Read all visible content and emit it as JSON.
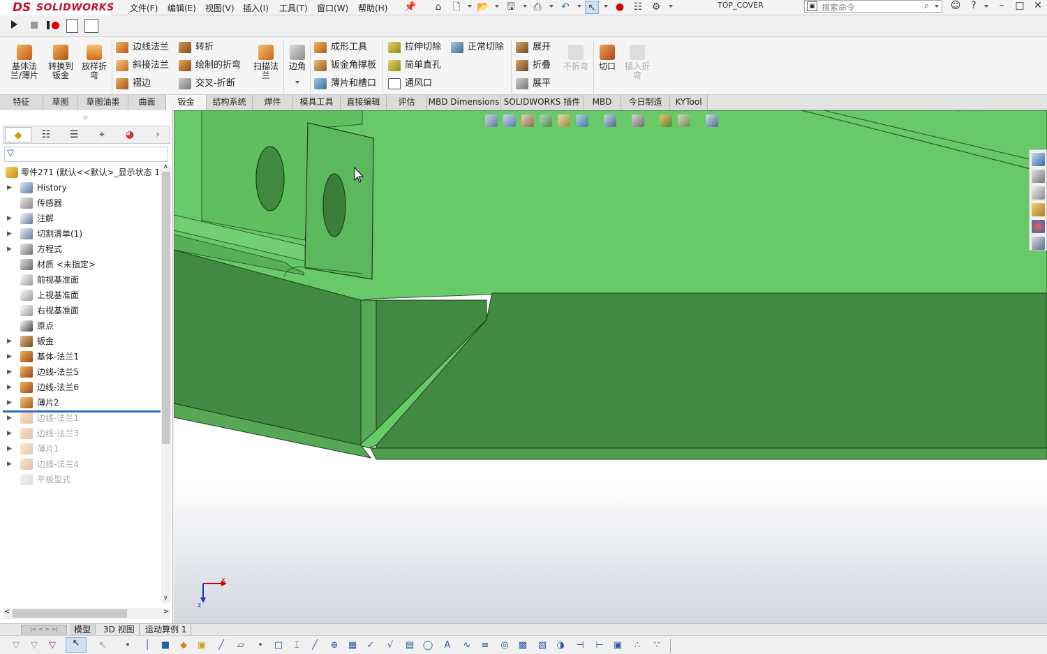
{
  "app": {
    "brand_ds": "DS",
    "brand_name": "SOLIDWORKS",
    "document_title": "TOP_COVER",
    "search_placeholder": "搜索命令"
  },
  "menu": [
    "文件(F)",
    "编辑(E)",
    "视图(V)",
    "插入(I)",
    "工具(T)",
    "窗口(W)",
    "帮助(H)"
  ],
  "ribbon": {
    "big_buttons": [
      {
        "label": "基体法\n兰/薄片",
        "icon": "base-flange-icon"
      },
      {
        "label": "转换到\n钣金",
        "icon": "convert-to-sheet-metal-icon"
      },
      {
        "label": "放样折\n弯",
        "icon": "lofted-bend-icon"
      }
    ],
    "col1": [
      "边线法兰",
      "斜接法兰",
      "褶边"
    ],
    "col2": [
      "转折",
      "绘制的折弯",
      "交叉-折断"
    ],
    "sweep_flange": "扫描法\n兰",
    "corner": "边角",
    "col3": [
      "成形工具",
      "钣金角撑板",
      "薄片和槽口"
    ],
    "col4": [
      "拉伸切除",
      "简单直孔",
      "通风口"
    ],
    "normal_cut": "正常切除",
    "col5": [
      "展开",
      "折叠",
      "展平"
    ],
    "no_bends": "不折弯",
    "rip": "切口",
    "insert_bends": "插入折\n弯"
  },
  "tabs": [
    "特征",
    "草图",
    "草图油墨",
    "曲面",
    "钣金",
    "结构系统",
    "焊件",
    "模具工具",
    "直接编辑",
    "评估",
    "MBD Dimensions",
    "SOLIDWORKS 插件",
    "MBD",
    "今日制造",
    "KYTool"
  ],
  "active_tab": "钣金",
  "tree": {
    "root": "零件271 (默认<<默认>_显示状态 1>",
    "items": [
      {
        "label": "History",
        "icon": "history-folder-icon",
        "expandable": true,
        "suppressed": false
      },
      {
        "label": "传感器",
        "icon": "sensor-folder-icon",
        "expandable": false,
        "suppressed": false
      },
      {
        "label": "注解",
        "icon": "annotation-icon",
        "expandable": true,
        "suppressed": false
      },
      {
        "label": "切割清单(1)",
        "icon": "cut-list-icon",
        "expandable": true,
        "suppressed": false
      },
      {
        "label": "方程式",
        "icon": "equation-icon",
        "expandable": true,
        "suppressed": false
      },
      {
        "label": "材质 <未指定>",
        "icon": "material-icon",
        "expandable": false,
        "suppressed": false
      },
      {
        "label": "前视基准面",
        "icon": "plane-icon",
        "expandable": false,
        "suppressed": false
      },
      {
        "label": "上视基准面",
        "icon": "plane-icon",
        "expandable": false,
        "suppressed": false
      },
      {
        "label": "右视基准面",
        "icon": "plane-icon",
        "expandable": false,
        "suppressed": false
      },
      {
        "label": "原点",
        "icon": "origin-icon",
        "expandable": false,
        "suppressed": false
      },
      {
        "label": "钣金",
        "icon": "sheet-metal-icon",
        "expandable": true,
        "suppressed": false
      },
      {
        "label": "基体-法兰1",
        "icon": "base-flange-icon",
        "expandable": true,
        "suppressed": false
      },
      {
        "label": "边线-法兰5",
        "icon": "edge-flange-icon",
        "expandable": true,
        "suppressed": false
      },
      {
        "label": "边线-法兰6",
        "icon": "edge-flange-icon",
        "expandable": true,
        "suppressed": false
      },
      {
        "label": "薄片2",
        "icon": "tab-feature-icon",
        "expandable": true,
        "suppressed": false
      },
      {
        "label": "边线-法兰1",
        "icon": "edge-flange-icon",
        "expandable": true,
        "suppressed": true
      },
      {
        "label": "边线-法兰3",
        "icon": "edge-flange-icon",
        "expandable": true,
        "suppressed": true
      },
      {
        "label": "薄片1",
        "icon": "tab-feature-icon",
        "expandable": true,
        "suppressed": true
      },
      {
        "label": "边线-法兰4",
        "icon": "edge-flange-icon",
        "expandable": true,
        "suppressed": true
      },
      {
        "label": "平板型式",
        "icon": "flat-pattern-icon",
        "expandable": false,
        "suppressed": true
      }
    ]
  },
  "bottom_tabs": [
    "模型",
    "3D 视图",
    "运动算例 1"
  ],
  "active_bottom_tab": "模型",
  "triad": {
    "x": "x",
    "z": "z"
  },
  "colors": {
    "part_light": "#67c967",
    "part_dark": "#418a41",
    "background_top": "#ffffff",
    "background_bottom": "#d3d6e0",
    "accent": "#2a6ebb"
  }
}
